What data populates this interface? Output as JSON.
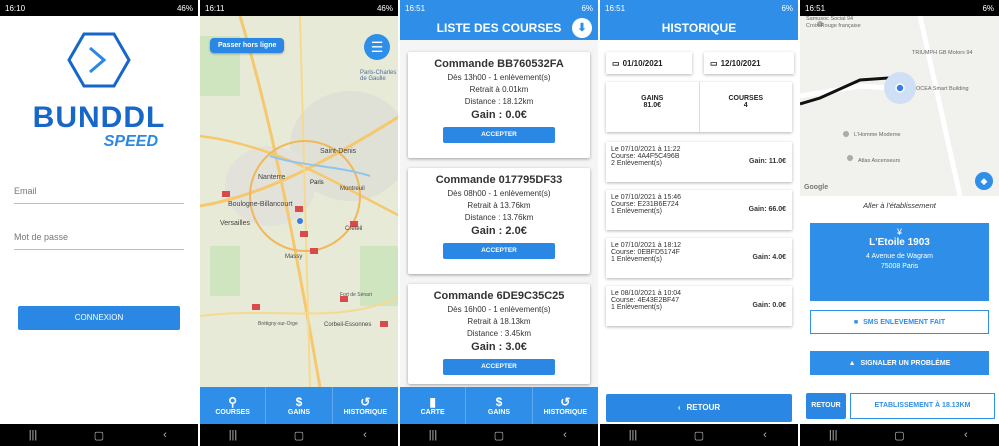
{
  "colors": {
    "primary": "#2f8ee8",
    "dark_blue": "#1667c9"
  },
  "login": {
    "status_time": "16:10",
    "status_right": "46%",
    "brand": "BUNDDL",
    "subbrand": "SPEED",
    "email_label": "Email",
    "password_label": "Mot de passe",
    "login_button": "CONNEXION"
  },
  "map_screen": {
    "status_time": "16:11",
    "status_right": "46%",
    "offline_button": "Passer hors ligne",
    "places": [
      "Paris-Charles de Gaulle",
      "Nanterre",
      "Saint-Denis",
      "Paris",
      "Montreuil",
      "Boulogne-Billancourt",
      "Versailles",
      "Créteil",
      "Massy",
      "Brétigny-sur-Orge",
      "Corbeil-Essonnes",
      "Fort de Sénart"
    ],
    "tabs": [
      {
        "icon": "bike-icon",
        "label": "COURSES"
      },
      {
        "icon": "dollar-icon",
        "label": "GAINS"
      },
      {
        "icon": "history-icon",
        "label": "HISTORIQUE"
      }
    ]
  },
  "orders": {
    "status_time": "16:51",
    "status_right": "6%",
    "title": "LISTE DES COURSES",
    "items": [
      {
        "title": "Commande BB760532FA",
        "time": "Dès 13h00 - 1 enlèvement(s)",
        "pickup": "Retrait à 0.01km",
        "distance": "Distance : 18.12km",
        "gain": "Gain :  0.0€",
        "action": "ACCEPTER"
      },
      {
        "title": "Commande 017795DF33",
        "time": "Dès 08h00 - 1 enlèvement(s)",
        "pickup": "Retrait à 13.76km",
        "distance": "Distance : 13.76km",
        "gain": "Gain :  2.0€",
        "action": "ACCEPTER"
      },
      {
        "title": "Commande 6DE9C35C25",
        "time": "Dès 16h00 - 1 enlèvement(s)",
        "pickup": "Retrait à 18.13km",
        "distance": "Distance : 3.45km",
        "gain": "Gain :  3.0€",
        "action": "ACCEPTER"
      }
    ],
    "tabs": [
      {
        "label": "CARTE"
      },
      {
        "label": "GAINS"
      },
      {
        "label": "HISTORIQUE"
      }
    ]
  },
  "history": {
    "status_time": "16:51",
    "status_right": "6%",
    "title": "HISTORIQUE",
    "date_from": "01/10/2021",
    "date_to": "12/10/2021",
    "gains_label": "GAINS",
    "gains_value": "81.0€",
    "courses_label": "COURSES",
    "courses_value": "4",
    "entries": [
      {
        "date": "Le 07/10/2021 à 11:22",
        "course": "Course: 4A4F5C496B",
        "pickups": "2 Enlèvement(s)",
        "gain": "Gain: 11.0€"
      },
      {
        "date": "Le 07/10/2021 à 15:46",
        "course": "Course: E231B6E724",
        "pickups": "1 Enlèvement(s)",
        "gain": "Gain: 66.0€"
      },
      {
        "date": "Le 07/10/2021 à 18:12",
        "course": "Course: 0EBFD5174F",
        "pickups": "1 Enlèvement(s)",
        "gain": "Gain: 4.0€"
      },
      {
        "date": "Le 08/10/2021 à 10:04",
        "course": "Course: 4E43E2BF47",
        "pickups": "1 Enlèvement(s)",
        "gain": "Gain: 0.0€"
      }
    ],
    "back_button": "RETOUR"
  },
  "route": {
    "status_time": "16:51",
    "status_right": "6%",
    "map_places": [
      "Samusoc Social 94",
      "Croix-Rouge française",
      "TRIUMPH GB Motors 94",
      "OCEA Smart Building",
      "L'Homme Moderne",
      "Atlas Ascenseurs"
    ],
    "google": "Google",
    "instruction": "Aller à l'établissement",
    "establishment": "L'Etoile 1903",
    "address1": "4 Avenue de Wagram",
    "address2": "75008 Paris",
    "sms_button": "SMS ENLEVEMENT FAIT",
    "problem_button": "SIGNALER UN PROBLÈME",
    "back_button": "RETOUR",
    "distance_button": "ETABLISSEMENT À 18.13KM"
  }
}
